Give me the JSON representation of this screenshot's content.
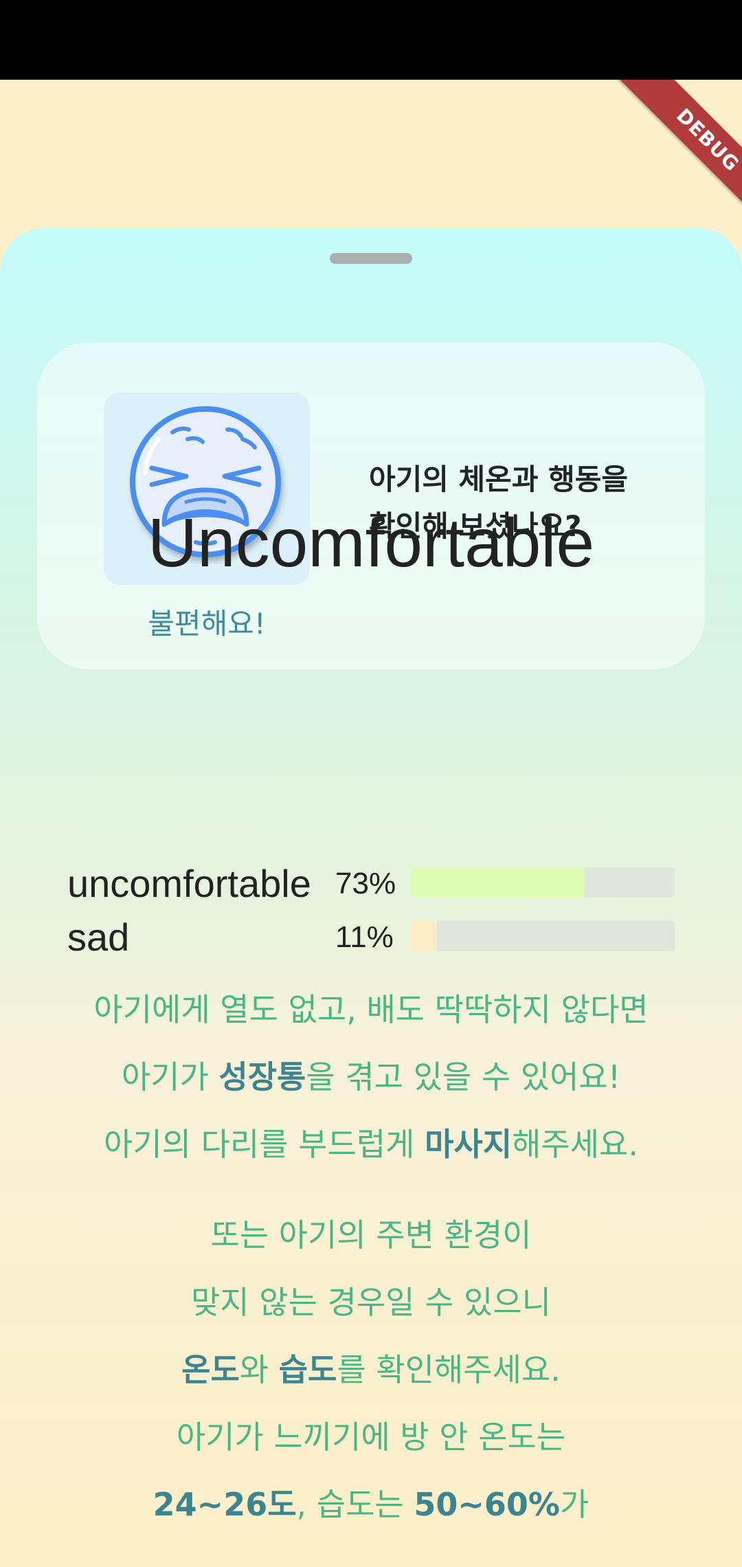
{
  "debug_banner": {
    "label": "DEBUG",
    "color": "#b23b3b"
  },
  "card": {
    "emoji_icon": "weary-face-icon",
    "emoji_label": "불편해요!",
    "question_line1": "아기의 체온과 행동을",
    "question_line2": "확인해 보셨나요?"
  },
  "result": {
    "title": "Uncomfortable"
  },
  "probabilities": [
    {
      "label": "uncomfortable",
      "percent_text": "73%",
      "fraction": 0.66,
      "color": "#ddfcb2"
    },
    {
      "label": "sad",
      "percent_text": "11%",
      "fraction": 0.1,
      "color": "#fdecc7"
    }
  ],
  "advice": {
    "l1": "아기에게 열도 없고, 배도 딱딱하지 않다면",
    "l2_a": "아기가 ",
    "l2_b": "성장통",
    "l2_c": "을 겪고 있을 수 있어요!",
    "l3_a": "아기의 다리를 부드럽게 ",
    "l3_b": "마사지",
    "l3_c": "해주세요.",
    "l4": "또는 아기의 주변 환경이",
    "l5": "맞지 않는 경우일 수 있으니",
    "l6_a": "온도",
    "l6_b": "와 ",
    "l6_c": "습도",
    "l6_d": "를 확인해주세요.",
    "l7": "아기가 느끼기에 방 안 온도는",
    "l8_a": "24~26도",
    "l8_b": ", 습도는 ",
    "l8_c": "50~60%",
    "l8_d": "가"
  },
  "colors": {
    "background": "#fdefc8",
    "sheet_top": "#c3fbfa",
    "advice_text": "#49b687",
    "advice_emphasis": "#3a8590"
  }
}
